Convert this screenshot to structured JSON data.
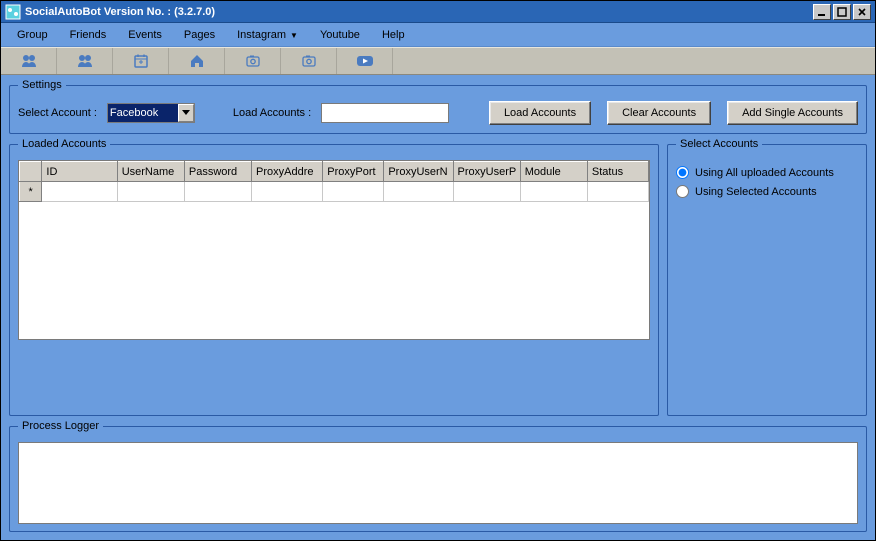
{
  "title": "SocialAutoBot  Version No. :  (3.2.7.0)",
  "menu": {
    "group": "Group",
    "friends": "Friends",
    "events": "Events",
    "pages": "Pages",
    "instagram": "Instagram",
    "youtube": "Youtube",
    "help": "Help"
  },
  "toolbar_icons": [
    "group-icon",
    "group-icon",
    "calendar-icon",
    "home-icon",
    "camera-icon",
    "camera-icon",
    "video-icon"
  ],
  "settings": {
    "legend": "Settings",
    "select_account_label": "Select Account  :",
    "select_account_value": "Facebook",
    "load_accounts_label": "Load Accounts  :",
    "load_accounts_value": "",
    "btn_load": "Load Accounts",
    "btn_clear": "Clear Accounts",
    "btn_add": "Add Single Accounts"
  },
  "loaded": {
    "legend": "Loaded Accounts",
    "columns": [
      "ID",
      "UserName",
      "Password",
      "ProxyAddre",
      "ProxyPort",
      "ProxyUserN",
      "ProxyUserP",
      "Module",
      "Status"
    ],
    "row_marker": "*"
  },
  "select_accounts": {
    "legend": "Select Accounts",
    "opt_all": "Using All uploaded Accounts",
    "opt_selected": "Using Selected Accounts",
    "selected": "all"
  },
  "logger": {
    "legend": "Process Logger"
  }
}
